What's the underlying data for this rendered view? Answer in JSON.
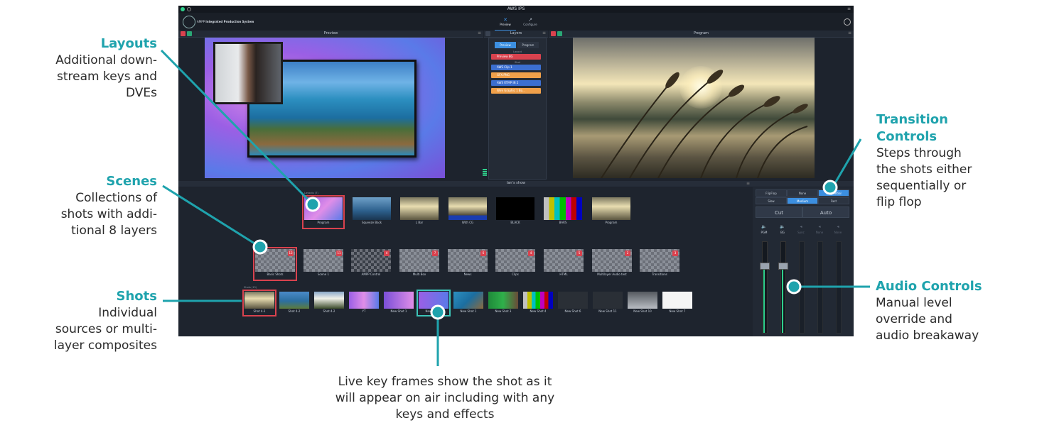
{
  "app": {
    "window_title": "AWS IPS",
    "brand": "AMPP",
    "brand_sub": "Integrated Production System",
    "tabs": [
      {
        "label": "Preview"
      },
      {
        "label": "Configure"
      }
    ],
    "panels": {
      "preview": "Preview",
      "layers": "Layers",
      "program": "Program"
    },
    "layers_panel": {
      "toggle": [
        "Preview",
        "Program"
      ],
      "sections": [
        "Layout",
        "Shot"
      ],
      "rows": [
        {
          "label": "Preview BG",
          "color": "#d9424e"
        },
        {
          "label": "AWS Clip 1",
          "color": "#3c6fd0"
        },
        {
          "label": "GFX.PNG",
          "color": "#f0a04a"
        },
        {
          "label": "AWS RTMP IN 2",
          "color": "#3c6fd0"
        },
        {
          "label": "Wire Graphic 1 Bo...",
          "color": "#f0a04a"
        }
      ]
    },
    "show_label": "Ian's show",
    "sections": {
      "layouts": "Layouts (7)",
      "scenes": "Scenes (9)",
      "shots": "Shots (13)"
    },
    "layouts": [
      "Program",
      "Squeeze Back",
      "L Bar",
      "With CG",
      "BLACK",
      "BARS",
      "Program"
    ],
    "scenes": [
      {
        "label": "Basic Shots",
        "badge": "13"
      },
      {
        "label": "Scene 1",
        "badge": "11"
      },
      {
        "label": "AMPP Control",
        "badge": "4"
      },
      {
        "label": "Multi Box",
        "badge": "7"
      },
      {
        "label": "News",
        "badge": "6"
      },
      {
        "label": "Clips",
        "badge": "4"
      },
      {
        "label": "HTML",
        "badge": "5"
      },
      {
        "label": "Multilayer Audio test",
        "badge": "2"
      },
      {
        "label": "Transitions",
        "badge": "3"
      }
    ],
    "shots": [
      "Shot 4-1",
      "Shot 4-2",
      "Shot 4-2",
      "YT",
      "New Shot 1",
      "New Shot 1",
      "New Shot 1",
      "New Shot 3",
      "New Shot 4",
      "New Shot 6",
      "New Shot 11",
      "New Shot 10",
      "New Shot 7"
    ],
    "transition": {
      "row1": [
        "FlipFlop",
        "None",
        "Sequential"
      ],
      "row2": [
        "Slow",
        "Medium",
        "Fast"
      ],
      "cut": "Cut",
      "auto": "Auto"
    },
    "audio": {
      "channels": [
        {
          "label": "PGM"
        },
        {
          "label": "BG"
        },
        {
          "label": "Sync"
        },
        {
          "label": "None"
        },
        {
          "label": "None"
        }
      ],
      "active_color": "#2fd08c"
    },
    "colors": {
      "accent": "#3c8fe0",
      "selected": "#d9424e",
      "live": "#3cc4b8"
    }
  },
  "callouts": {
    "layouts": {
      "title": "Layouts",
      "lines": [
        "Additional down-",
        "stream keys and",
        "DVEs"
      ]
    },
    "scenes": {
      "title": "Scenes",
      "lines": [
        "Collections of",
        "shots with addi-",
        "tional 8 layers"
      ]
    },
    "shots": {
      "title": "Shots",
      "lines": [
        "Individual",
        "sources or multi-",
        "layer composites"
      ]
    },
    "transition": {
      "title_lines": [
        "Transition",
        "Controls"
      ],
      "lines": [
        "Steps through",
        "the shots either",
        "sequentially or",
        "flip flop"
      ]
    },
    "audio": {
      "title": "Audio Controls",
      "lines": [
        "Manual level",
        "override and",
        "audio breakaway"
      ]
    },
    "live": {
      "lines": [
        "Live key frames show the shot as it",
        "will appear on air including with any",
        "keys and effects"
      ]
    }
  }
}
